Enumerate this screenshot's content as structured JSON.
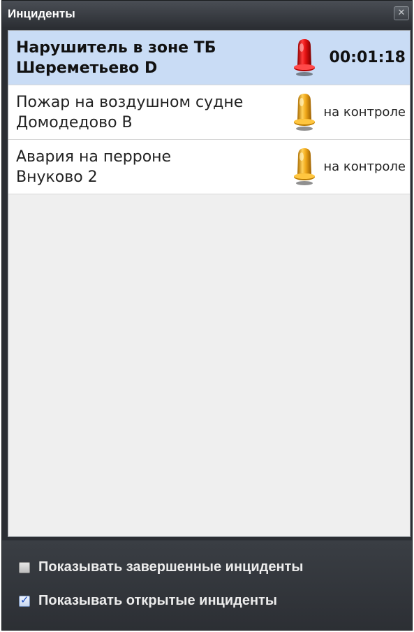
{
  "window": {
    "title": "Инциденты",
    "close_glyph": "✕"
  },
  "incidents": [
    {
      "line1": "Нарушитель в зоне ТБ",
      "line2": "Шереметьево D",
      "status": "00:01:18",
      "icon": "red-beacon-icon",
      "icon_color": "#e01010",
      "selected": true
    },
    {
      "line1": "Пожар на воздушном судне",
      "line2": "Домодедово B",
      "status": "на контроле",
      "icon": "amber-beacon-icon",
      "icon_color": "#f0a81a",
      "selected": false
    },
    {
      "line1": "Авария на перроне",
      "line2": "Внуково 2",
      "status": "на контроле",
      "icon": "amber-beacon-icon",
      "icon_color": "#f0a81a",
      "selected": false
    }
  ],
  "footer": {
    "show_closed": {
      "label": "Показывать завершенные инциденты",
      "checked": false
    },
    "show_open": {
      "label": "Показывать открытые инциденты",
      "checked": true
    }
  },
  "colors": {
    "selected_row": "#c9dcf5",
    "titlebar": "#3a3e44"
  }
}
